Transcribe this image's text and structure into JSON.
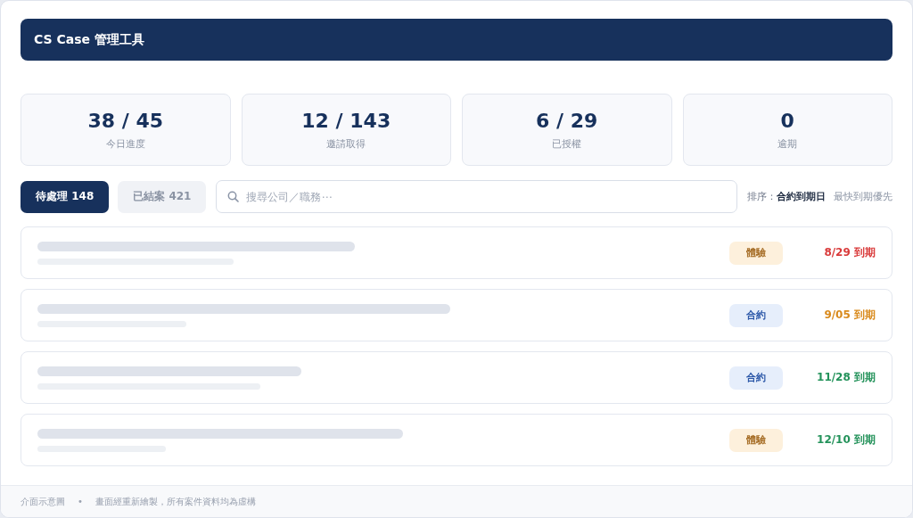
{
  "header": {
    "title": "CS Case 管理工具"
  },
  "stats": [
    {
      "value": "38 / 45",
      "label": "今日進度"
    },
    {
      "value": "12 / 143",
      "label": "邀請取得"
    },
    {
      "value": "6 / 29",
      "label": "已授權"
    },
    {
      "value": "0",
      "label": "逾期"
    }
  ],
  "tabs": [
    {
      "label": "待處理 148",
      "selected": true
    },
    {
      "label": "已結案 421",
      "selected": false
    }
  ],
  "search": {
    "placeholder": "搜尋公司／職務⋯"
  },
  "sort": {
    "label": "排序：",
    "value": "合約到期日",
    "order": "最快到期優先"
  },
  "cases": [
    {
      "tag": {
        "kind": "trial",
        "label": "體驗"
      },
      "due": "8/29 到期",
      "color": "#d93a3a"
    },
    {
      "tag": {
        "kind": "contract",
        "label": "合約"
      },
      "due": "9/05 到期",
      "color": "#d98a1c"
    },
    {
      "tag": {
        "kind": "contract",
        "label": "合約"
      },
      "due": "11/28 到期",
      "color": "#23925a"
    },
    {
      "tag": {
        "kind": "trial",
        "label": "體驗"
      },
      "due": "12/10 到期",
      "color": "#23925a"
    }
  ],
  "footer": {
    "note": "介面示意圖",
    "separator": "•",
    "disclaimer": "畫面經重新繪製，所有案件資料均為虛構"
  }
}
